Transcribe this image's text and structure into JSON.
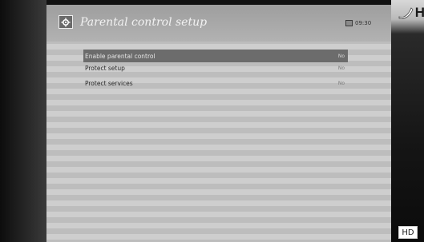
{
  "title": "Parental control setup",
  "clock": "09:30",
  "menu": {
    "items": [
      {
        "label": "Enable parental control",
        "value": "No",
        "selected": true
      },
      {
        "label": "Protect setup",
        "value": "No",
        "selected": false
      },
      {
        "label": "Protect services",
        "value": "No",
        "selected": false
      }
    ]
  },
  "badge": "HD",
  "corner_logo_letter": "H",
  "icons": {
    "title": "gear-icon",
    "clock": "clock-icon",
    "corner_logo": "channel-logo-icon"
  },
  "colors": {
    "selection": "#6c6c6c",
    "title_text": "#f2f2f2",
    "stripe_light": "#cecece",
    "stripe_dark": "#bdbdbd"
  }
}
